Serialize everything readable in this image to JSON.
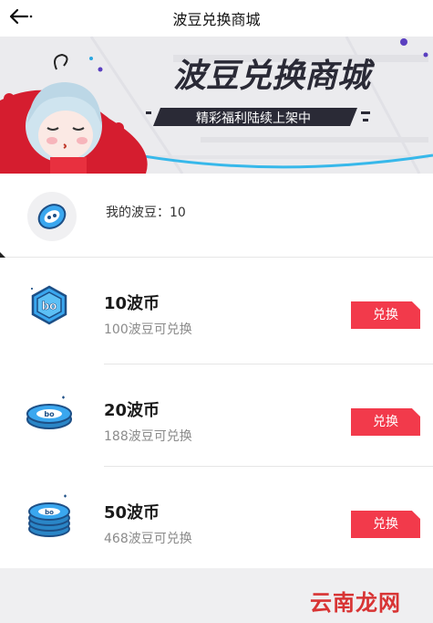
{
  "header": {
    "title": "波豆兑换商城"
  },
  "banner": {
    "title": "波豆兑换商城",
    "subtitle": "精彩福利陆续上架中",
    "colors": {
      "accent": "#d51d2f",
      "dark": "#2a2a36",
      "bg": "#ebebee"
    }
  },
  "balance": {
    "text": "我的波豆：10"
  },
  "items": [
    {
      "name": "10波币",
      "cost": "100波豆可兑换",
      "button": "兑换",
      "icon": "coin-single-icon"
    },
    {
      "name": "20波币",
      "cost": "188波豆可兑换",
      "button": "兑换",
      "icon": "coin-stack-icon"
    },
    {
      "name": "50波币",
      "cost": "468波豆可兑换",
      "button": "兑换",
      "icon": "coin-pile-icon"
    }
  ],
  "watermark": "云南龙网",
  "colors": {
    "button": "#f23a4b",
    "coin": "#3aa7ef"
  }
}
